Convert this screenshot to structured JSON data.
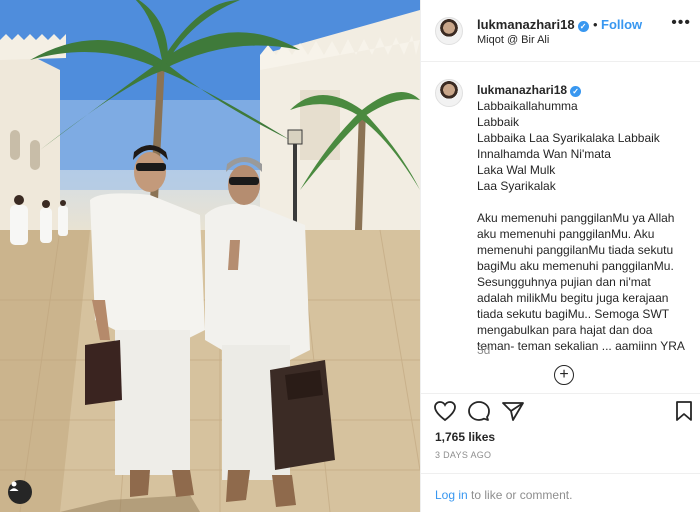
{
  "post": {
    "username": "lukmanazhari18",
    "verified_icon": "verified-badge-icon",
    "separator": "•",
    "follow_label": "Follow",
    "location": "Miqot @ Bir Ali",
    "more_label": "•••"
  },
  "caption": {
    "username": "lukmanazhari18",
    "first_line": "Labbaikallahumma",
    "lines": [
      "Labbaik",
      "Labbaika Laa Syarikalaka Labbaik",
      "Innalhamda Wan Ni'mata",
      "Laka Wal Mulk",
      "Laa Syarikalak"
    ],
    "paragraph": "Aku memenuhi panggilanMu ya Allah aku memenuhi panggilanMu. Aku memenuhi panggilanMu tiada sekutu bagiMu aku memenuhi panggilanMu. Sesungguhnya pujian dan ni'mat adalah milikMu begitu juga kerajaan tiada sekutu bagiMu.. Semoga SWT mengabulkan para hajat dan doa teman- teman sekalian ... aamiinn YRA",
    "time": "3d",
    "load_more": "+"
  },
  "actions": {
    "likes": "1,765 likes",
    "posted_ago": "3 DAYS AGO"
  },
  "footer": {
    "login_link": "Log in",
    "login_rest": " to like or comment."
  },
  "colors": {
    "accent": "#3897f0",
    "muted": "#8e8e8e",
    "text": "#262626"
  }
}
